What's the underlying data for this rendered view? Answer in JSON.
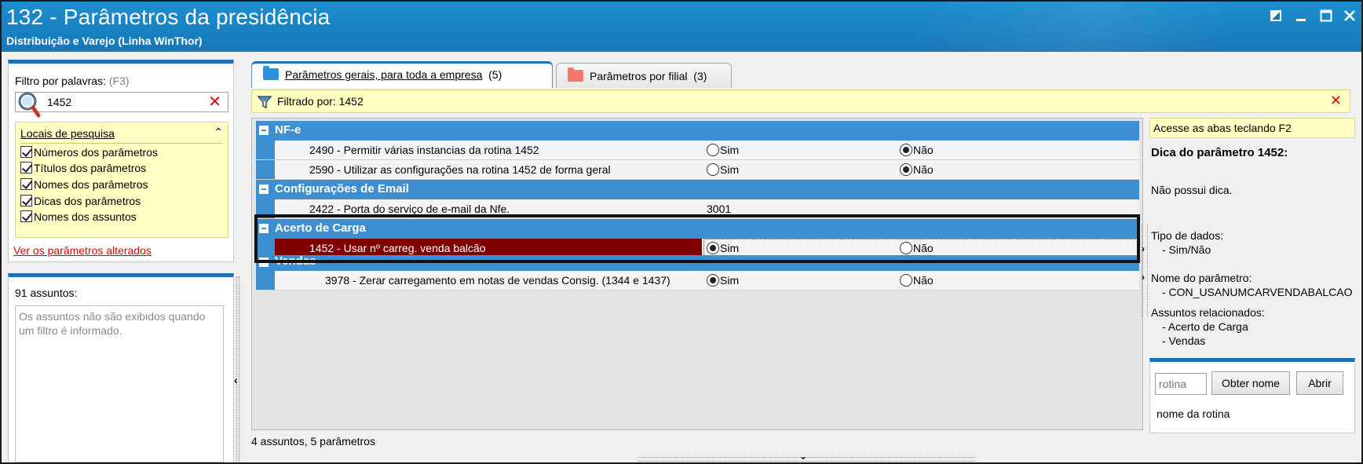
{
  "window": {
    "title": "132 - Parâmetros da presidência",
    "subtitle": "Distribuição e Varejo (Linha WinThor)"
  },
  "left": {
    "filter_label": "Filtro por palavras:",
    "filter_hint": "(F3)",
    "search_value": "1452",
    "locais": {
      "header": "Locais de pesquisa",
      "options": [
        {
          "label": "Números dos parâmetros",
          "checked": true
        },
        {
          "label": "Títulos dos parâmetros",
          "checked": true
        },
        {
          "label": "Nomes dos parâmetros",
          "checked": true
        },
        {
          "label": "Dicas dos parâmetros",
          "checked": true
        },
        {
          "label": "Nomes dos assuntos",
          "checked": true
        }
      ]
    },
    "altered_link": "Ver os parâmetros alterados",
    "assuntos_count": "91 assuntos:",
    "assuntos_message": "Os assuntos não são exibidos quando um filtro é informado."
  },
  "tabs": [
    {
      "label": "Parâmetros gerais, para toda a empresa",
      "count": "(5)",
      "active": true,
      "icon": "blue-folder-icon"
    },
    {
      "label": "Parâmetros por filial",
      "count": "(3)",
      "active": false,
      "icon": "red-folder-icon"
    }
  ],
  "filter_bar": {
    "text": "Filtrado por: 1452"
  },
  "grid": {
    "groups": [
      {
        "name": "NF-e",
        "params": [
          {
            "label": "2490 - Permitir várias instancias da rotina 1452",
            "value": "Não"
          },
          {
            "label": "2590 - Utilizar as configurações na rotina 1452 de forma geral",
            "value": "Não"
          }
        ]
      },
      {
        "name": "Configurações de Email",
        "params": [
          {
            "label": "2422 - Porta do serviço de e-mail da Nfe.",
            "value": "3001"
          }
        ]
      },
      {
        "name": "Acerto de Carga",
        "params": [
          {
            "label": "1452 - Usar nº carreg. venda balcão",
            "value": "Sim",
            "selected": true
          }
        ]
      },
      {
        "name": "Vendas",
        "params": [
          {
            "label": "3978 - Zerar carregamento em notas de vendas Consig. (1344 e 1437)",
            "value": "Sim"
          }
        ]
      }
    ],
    "radio_yes": "Sim",
    "radio_no": "Não"
  },
  "status": "4 assuntos, 5 parâmetros",
  "right": {
    "tip_bar": "Acesse as abas teclando F2",
    "tip_title": "Dica do parâmetro 1452:",
    "tip_text": "Não possui dica.",
    "data_type_label": "Tipo de dados:",
    "data_type_value": "- Sim/Não",
    "param_name_label": "Nome do parâmetro:",
    "param_name_value": "- CON_USANUMCARVENDABALCAO",
    "related_label": "Assuntos relacionados:",
    "related": [
      "- Acerto de Carga",
      "- Vendas"
    ],
    "routine_placeholder": "rotina",
    "obter_button": "Obter nome",
    "abrir_button": "Abrir",
    "routine_caption": "nome da rotina"
  },
  "colors": {
    "titlebar": "#1877b8",
    "group_header": "#3d8fd1",
    "selected_row": "#800000",
    "yellow_panel": "#ffffc4",
    "clear_red": "#e00000"
  }
}
